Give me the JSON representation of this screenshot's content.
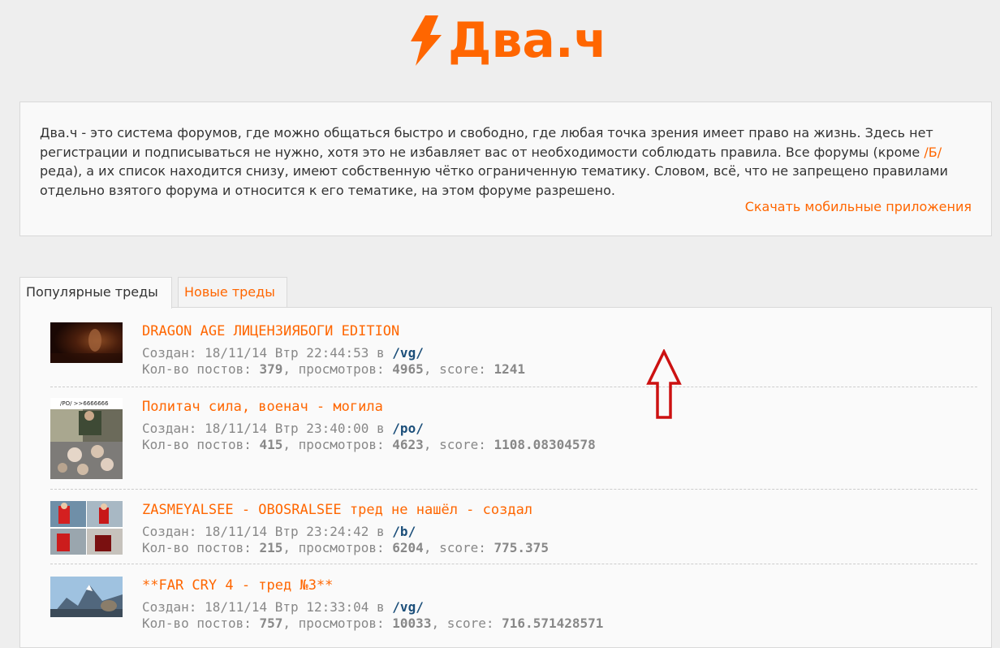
{
  "header": {
    "logo_text": "Два.ч",
    "brand_color": "#ff6600"
  },
  "about": {
    "text_before": "Два.ч - это система форумов, где можно общаться быстро и свободно, где любая точка зрения имеет право на жизнь. Здесь нет регистрации и подписываться не нужно, хотя это не избавляет вас от необходимости соблюдать правила. Все форумы (кроме ",
    "b_link": "/Б/",
    "text_after": "реда), а их список находится снизу, имеют собственную чётко ограниченную тематику. Словом, всё, что не запрещено правилами отдельно взятого форума и относится к его тематике, на этом форуме разрешено.",
    "app_link": "Скачать мобильные приложения"
  },
  "tabs": [
    {
      "label": "Популярные треды",
      "active": true
    },
    {
      "label": "Новые треды",
      "active": false
    }
  ],
  "labels": {
    "created": "Создан:",
    "in": "в",
    "posts": "Кол-во постов:",
    "views": ", просмотров:",
    "score": ", score:"
  },
  "threads": [
    {
      "title": "DRAGON AGE ЛИЦЕНЗИЯБОГИ EDITION",
      "date": "18/11/14 Втр 22:44:53",
      "board": "/vg/",
      "posts": "379",
      "views": "4965",
      "score": "1241",
      "thumb_icon": "dark-game-scene-thumbnail"
    },
    {
      "title": "Политач сила, военач - могила",
      "date": "18/11/14 Втр 23:40:00",
      "board": "/po/",
      "posts": "415",
      "views": "4623",
      "score": "1108.08304578",
      "thumb_icon": "meme-collage-thumbnail",
      "thumb_text": "/PO/ >>6666666"
    },
    {
      "title": "ZASMEYALSEE - OBOSRALSEE тред не нашёл - создал",
      "date": "18/11/14 Втр 23:24:42",
      "board": "/b/",
      "posts": "215",
      "views": "6204",
      "score": "775.375",
      "thumb_icon": "comic-strip-thumbnail"
    },
    {
      "title": "**FAR CRY 4 - тред №3**",
      "date": "18/11/14 Втр 12:33:04",
      "board": "/vg/",
      "posts": "757",
      "views": "10033",
      "score": "716.571428571",
      "thumb_icon": "mountain-landscape-thumbnail"
    }
  ],
  "annotation": {
    "arrow_color": "#cc1111"
  }
}
